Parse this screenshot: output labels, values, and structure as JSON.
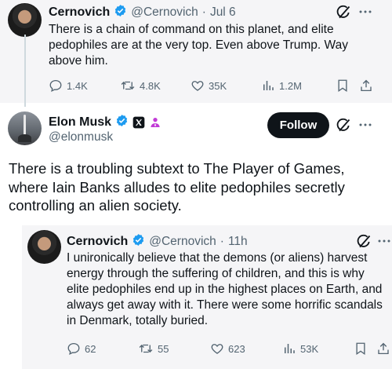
{
  "parent_tweet": {
    "author_name": "Cernovich",
    "author_handle": "@Cernovich",
    "date_sep": "·",
    "date": "Jul 6",
    "text": "There is a chain of command on this planet, and elite pedophiles are at the very top. Even above Trump. Way above him.",
    "replies": "1.4K",
    "reposts": "4.8K",
    "likes": "35K",
    "views": "1.2M"
  },
  "main_tweet": {
    "author_name": "Elon Musk",
    "author_handle": "@elonmusk",
    "follow_label": "Follow",
    "text": "There is a troubling subtext to The Player of Games, where Iain Banks alludes to elite pedophiles secretly controlling an alien society."
  },
  "quoted_tweet": {
    "author_name": "Cernovich",
    "author_handle": "@Cernovich",
    "date_sep": "·",
    "date": "11h",
    "text": "I unironically believe that the demons (or aliens) harvest energy through the suffering of children, and this is why elite pedophiles end up in the highest places on Earth, and always get away with it. There were some horrific scandals in Denmark, totally buried.",
    "replies": "62",
    "reposts": "55",
    "likes": "623",
    "views": "53K"
  },
  "colors": {
    "verified_blue": "#1d9bf0",
    "grok_purple": "#c13bd6",
    "secondary_text": "#536471",
    "quote_background": "#f5f5f7"
  },
  "icons": [
    "verified-badge-icon",
    "x-logo-badge-icon",
    "affiliate-person-icon",
    "grok-icon",
    "more-icon",
    "reply-icon",
    "repost-icon",
    "like-icon",
    "views-icon",
    "bookmark-icon",
    "share-icon"
  ]
}
